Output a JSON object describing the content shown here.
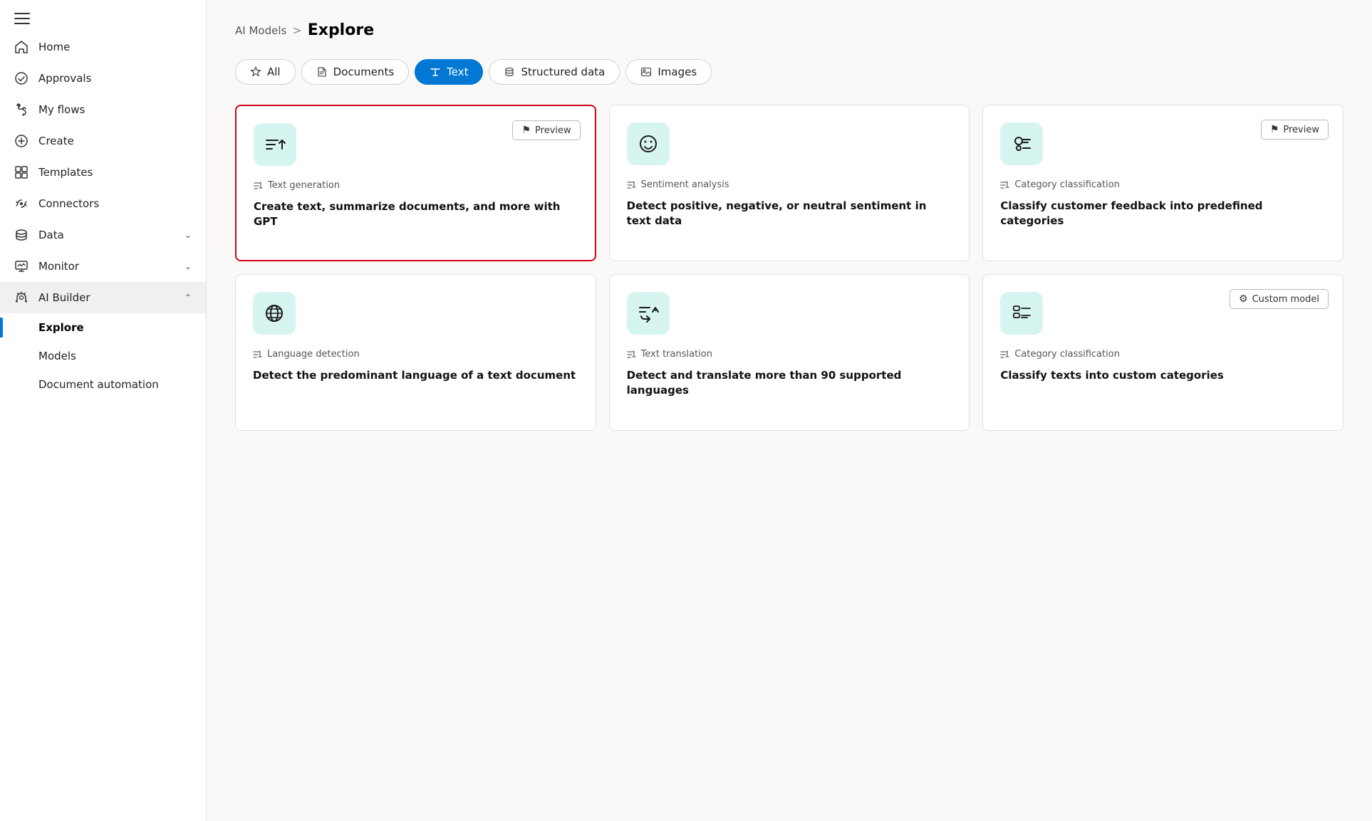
{
  "sidebar": {
    "nav_items": [
      {
        "id": "home",
        "label": "Home",
        "icon": "home-icon",
        "has_chevron": false
      },
      {
        "id": "approvals",
        "label": "Approvals",
        "icon": "approvals-icon",
        "has_chevron": false
      },
      {
        "id": "my-flows",
        "label": "My flows",
        "icon": "flows-icon",
        "has_chevron": false
      },
      {
        "id": "create",
        "label": "Create",
        "icon": "create-icon",
        "has_chevron": false
      },
      {
        "id": "templates",
        "label": "Templates",
        "icon": "templates-icon",
        "has_chevron": false
      },
      {
        "id": "connectors",
        "label": "Connectors",
        "icon": "connectors-icon",
        "has_chevron": false
      },
      {
        "id": "data",
        "label": "Data",
        "icon": "data-icon",
        "has_chevron": true
      },
      {
        "id": "monitor",
        "label": "Monitor",
        "icon": "monitor-icon",
        "has_chevron": true
      },
      {
        "id": "ai-builder",
        "label": "AI Builder",
        "icon": "ai-builder-icon",
        "has_chevron": true,
        "expanded": true
      }
    ],
    "sub_items": [
      {
        "id": "explore",
        "label": "Explore",
        "active": true
      },
      {
        "id": "models",
        "label": "Models",
        "active": false
      },
      {
        "id": "document-automation",
        "label": "Document automation",
        "active": false
      }
    ]
  },
  "breadcrumb": {
    "parent": "AI Models",
    "separator": ">",
    "current": "Explore"
  },
  "filter_tabs": [
    {
      "id": "all",
      "label": "All",
      "icon": "star-icon",
      "active": false
    },
    {
      "id": "documents",
      "label": "Documents",
      "icon": "documents-icon",
      "active": false
    },
    {
      "id": "text",
      "label": "Text",
      "icon": "text-icon",
      "active": true
    },
    {
      "id": "structured-data",
      "label": "Structured data",
      "icon": "structured-icon",
      "active": false
    },
    {
      "id": "images",
      "label": "Images",
      "icon": "images-icon",
      "active": false
    }
  ],
  "cards": [
    {
      "id": "text-generation",
      "highlighted": true,
      "badge": "Preview",
      "type_label": "Text generation",
      "title": "Create text, summarize documents, and more with GPT",
      "icon": "text-gen-icon"
    },
    {
      "id": "sentiment-analysis",
      "highlighted": false,
      "badge": null,
      "type_label": "Sentiment analysis",
      "title": "Detect positive, negative, or neutral sentiment in text data",
      "icon": "sentiment-icon"
    },
    {
      "id": "category-classification-1",
      "highlighted": false,
      "badge": "Preview",
      "type_label": "Category classification",
      "title": "Classify customer feedback into predefined categories",
      "icon": "category-icon"
    },
    {
      "id": "language-detection",
      "highlighted": false,
      "badge": null,
      "type_label": "Language detection",
      "title": "Detect the predominant language of a text document",
      "icon": "language-icon"
    },
    {
      "id": "text-translation",
      "highlighted": false,
      "badge": null,
      "type_label": "Text translation",
      "title": "Detect and translate more than 90 supported languages",
      "icon": "translation-icon"
    },
    {
      "id": "category-classification-2",
      "highlighted": false,
      "badge": "Custom model",
      "type_label": "Category classification",
      "title": "Classify texts into custom categories",
      "icon": "custom-category-icon"
    }
  ]
}
